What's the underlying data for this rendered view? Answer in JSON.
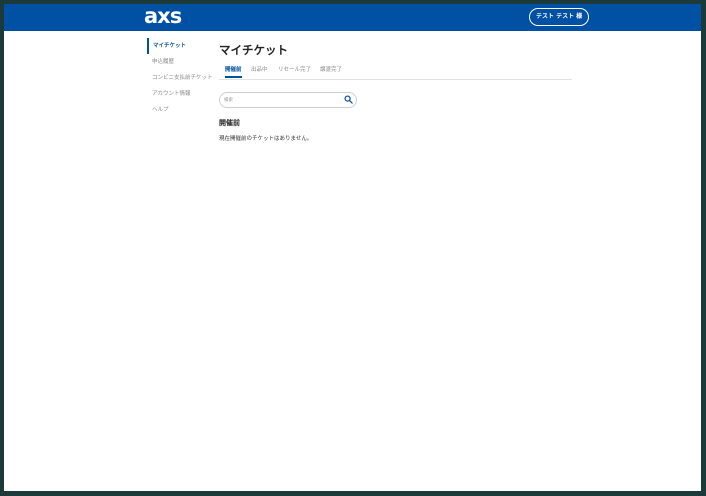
{
  "header": {
    "logo": "axs",
    "user_button": "テスト テスト 様"
  },
  "sidebar": {
    "items": [
      {
        "label": "マイチケット",
        "active": true
      },
      {
        "label": "申込履歴",
        "active": false
      },
      {
        "label": "コンビニ支払前チケット",
        "active": false
      },
      {
        "label": "アカウント情報",
        "active": false
      },
      {
        "label": "ヘルプ",
        "active": false
      }
    ]
  },
  "main": {
    "title": "マイチケット",
    "tabs": [
      {
        "label": "開催前",
        "active": true
      },
      {
        "label": "出品中",
        "active": false
      },
      {
        "label": "リセール完了",
        "active": false
      },
      {
        "label": "譲渡完了",
        "active": false
      }
    ],
    "search": {
      "placeholder": "検索",
      "value": ""
    },
    "section_title": "開催前",
    "empty_message": "現在開催前のチケットはありません。"
  },
  "colors": {
    "brand": "#0050a3",
    "background_border": "#1c3a3a"
  }
}
